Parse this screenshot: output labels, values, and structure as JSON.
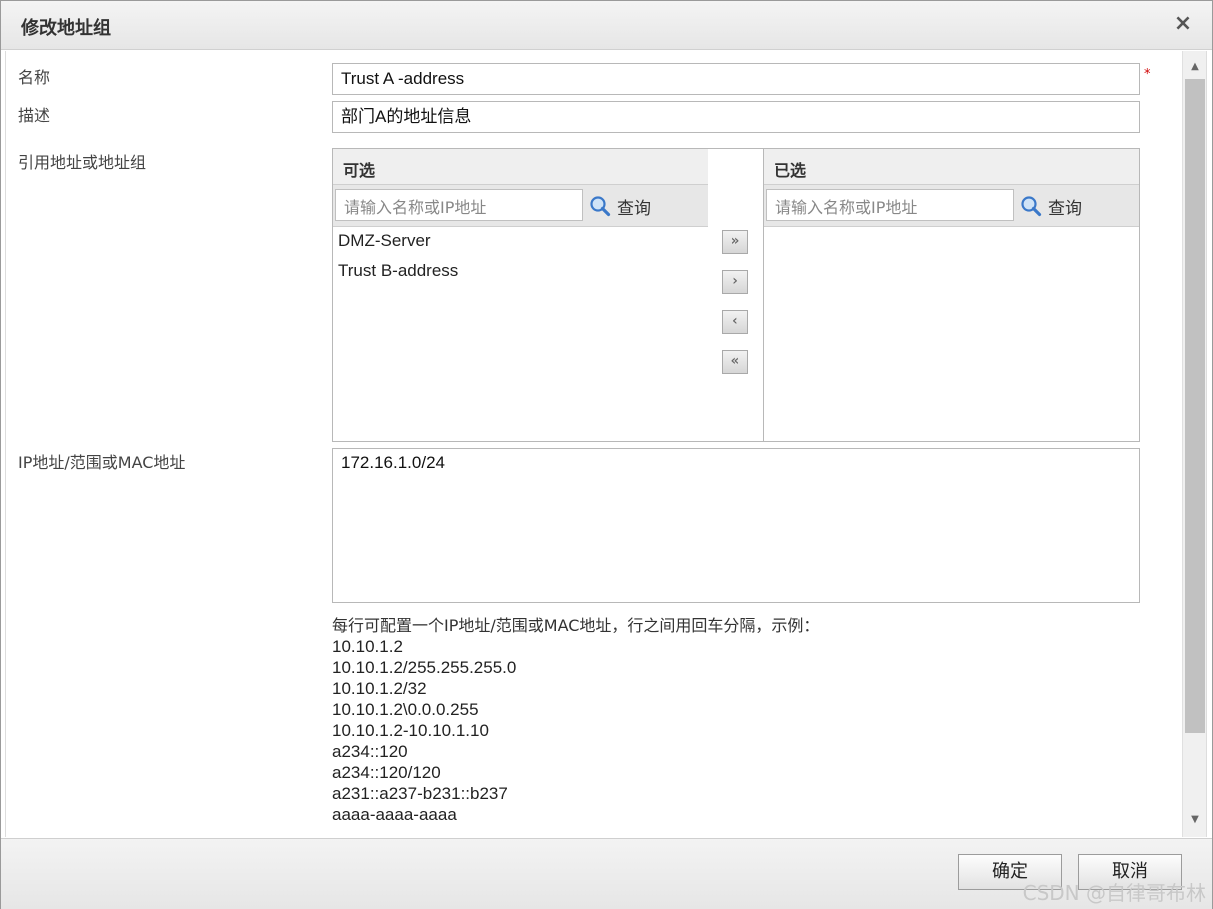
{
  "dialog": {
    "title": "修改地址组",
    "close_glyph": "×"
  },
  "form": {
    "name_label": "名称",
    "name_value": "Trust A -address",
    "required_mark": "*",
    "desc_label": "描述",
    "desc_value": "部门A的地址信息",
    "ref_label": "引用地址或地址组",
    "ip_label": "IP地址/范围或MAC地址",
    "ip_value": "172.16.1.0/24"
  },
  "transfer": {
    "available": {
      "header": "可选",
      "search_placeholder": "请输入名称或IP地址",
      "search_label": "查询",
      "items": [
        "DMZ-Server",
        "Trust B-address"
      ]
    },
    "selected": {
      "header": "已选",
      "search_placeholder": "请输入名称或IP地址",
      "search_label": "查询",
      "items": []
    },
    "buttons": {
      "add_all": "»",
      "add": "›",
      "remove": "‹",
      "remove_all": "«"
    }
  },
  "hint": {
    "text": "每行可配置一个IP地址/范围或MAC地址，行之间用回车分隔，示例：",
    "examples": [
      "10.10.1.2",
      "10.10.1.2/255.255.255.0",
      "10.10.1.2/32",
      "10.10.1.2\\0.0.0.255",
      "10.10.1.2-10.10.1.10",
      "a234::120",
      "a234::120/120",
      "a231::a237-b231::b237",
      "aaaa-aaaa-aaaa"
    ]
  },
  "footer": {
    "ok_label": "确定",
    "cancel_label": "取消",
    "watermark": "CSDN @自律哥布林"
  },
  "icons": {
    "search": "magnifier-icon",
    "close": "close-icon"
  },
  "colors": {
    "required": "#d00000",
    "search_icon": "#3a78c9"
  }
}
